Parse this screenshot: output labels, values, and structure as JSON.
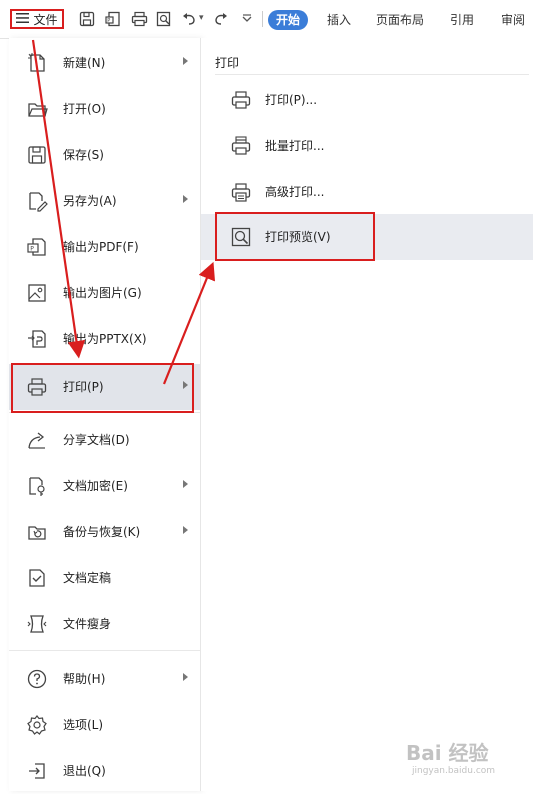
{
  "toolbar": {
    "file_label": "文件",
    "tabs": [
      "开始",
      "插入",
      "页面布局",
      "引用",
      "审阅"
    ],
    "active_tab": "开始",
    "icons": [
      "save-icon",
      "export-pdf-icon",
      "print-icon",
      "print-preview-icon",
      "undo-icon",
      "redo-icon",
      "customize-icon"
    ]
  },
  "menu": {
    "items": [
      {
        "label": "新建(N)",
        "icon": "new-document-icon",
        "has_submenu": true
      },
      {
        "label": "打开(O)",
        "icon": "open-folder-icon",
        "has_submenu": false
      },
      {
        "label": "保存(S)",
        "icon": "save-icon",
        "has_submenu": false
      },
      {
        "label": "另存为(A)",
        "icon": "save-as-icon",
        "has_submenu": true
      },
      {
        "label": "输出为PDF(F)",
        "icon": "export-pdf-icon",
        "has_submenu": false
      },
      {
        "label": "输出为图片(G)",
        "icon": "export-image-icon",
        "has_submenu": false
      },
      {
        "label": "输出为PPTX(X)",
        "icon": "export-pptx-icon",
        "has_submenu": false
      },
      {
        "label": "打印(P)",
        "icon": "print-icon",
        "has_submenu": true
      },
      {
        "label": "分享文档(D)",
        "icon": "share-icon",
        "has_submenu": false
      },
      {
        "label": "文档加密(E)",
        "icon": "encrypt-document-icon",
        "has_submenu": true
      },
      {
        "label": "备份与恢复(K)",
        "icon": "backup-restore-icon",
        "has_submenu": true
      },
      {
        "label": "文档定稿",
        "icon": "finalize-document-icon",
        "has_submenu": false
      },
      {
        "label": "文件瘦身",
        "icon": "slim-file-icon",
        "has_submenu": false
      },
      {
        "label": "帮助(H)",
        "icon": "help-icon",
        "has_submenu": true
      },
      {
        "label": "选项(L)",
        "icon": "gear-icon",
        "has_submenu": false
      },
      {
        "label": "退出(Q)",
        "icon": "exit-icon",
        "has_submenu": false
      }
    ],
    "selected": "打印(P)"
  },
  "submenu": {
    "header": "打印",
    "items": [
      {
        "label": "打印(P)...",
        "icon": "print-icon"
      },
      {
        "label": "批量打印...",
        "icon": "batch-print-icon"
      },
      {
        "label": "高级打印...",
        "icon": "advanced-print-icon"
      },
      {
        "label": "打印预览(V)",
        "icon": "print-preview-icon"
      }
    ],
    "selected": "打印预览(V)"
  },
  "annotation_colors": {
    "highlight": "#d91e1e",
    "accent": "#3b7dd8"
  },
  "watermark": {
    "text": "Bai 经验",
    "url": "jingyan.baidu.com"
  }
}
